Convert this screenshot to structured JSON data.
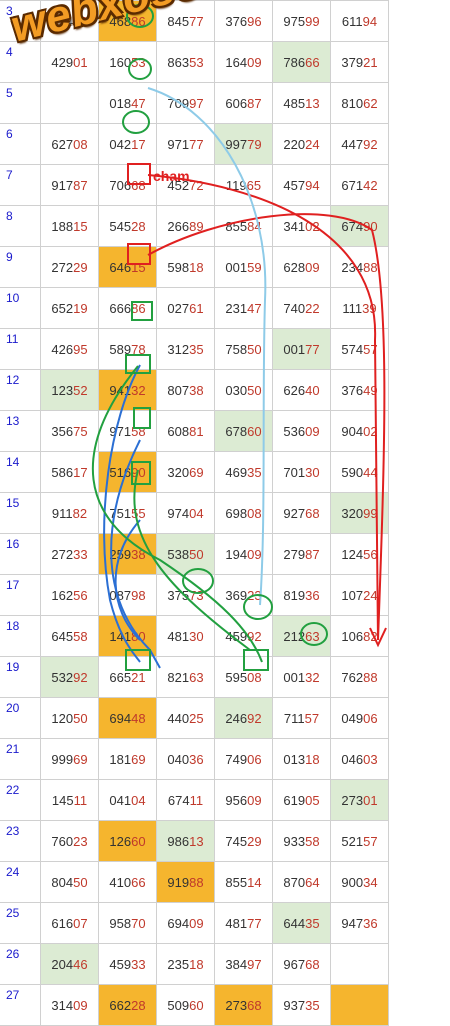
{
  "watermark": "webxoso.net",
  "annotation_label": "cham",
  "colors": {
    "orange": "#f5b52e",
    "green_cell": "#dcebd3",
    "row_number": "#1a1acc",
    "tail": "#c0392b",
    "red_arrow": "#e02020",
    "green_line": "#22a040",
    "blue_line": "#2b6fd4",
    "light_blue_line": "#8ecbe8"
  },
  "rows": [
    {
      "n": "3",
      "cells": [
        "75406",
        "46886",
        "84577",
        "37696",
        "97599",
        "61194"
      ],
      "hl": [
        "",
        "o",
        "",
        "",
        "",
        ""
      ]
    },
    {
      "n": "4",
      "cells": [
        "42901",
        "16053",
        "86353",
        "16409",
        "78666",
        "37921"
      ],
      "hl": [
        "",
        "",
        "",
        "",
        "g",
        ""
      ]
    },
    {
      "n": "5",
      "cells": [
        "",
        "01847",
        "70997",
        "60687",
        "48513",
        "81062"
      ],
      "hl": [
        "",
        "",
        "",
        "",
        "",
        ""
      ]
    },
    {
      "n": "6",
      "cells": [
        "62708",
        "04217",
        "97177",
        "99779",
        "22024",
        "44792"
      ],
      "hl": [
        "",
        "",
        "",
        "g",
        "",
        ""
      ]
    },
    {
      "n": "7",
      "cells": [
        "91787",
        "70668",
        "45272",
        "11965",
        "45794",
        "67142"
      ],
      "hl": [
        "",
        "",
        "",
        "",
        "",
        ""
      ]
    },
    {
      "n": "8",
      "cells": [
        "18815",
        "54528",
        "26689",
        "85584",
        "34102",
        "67490"
      ],
      "hl": [
        "",
        "",
        "",
        "",
        "",
        "g"
      ]
    },
    {
      "n": "9",
      "cells": [
        "27229",
        "64615",
        "59818",
        "00159",
        "62809",
        "23488"
      ],
      "hl": [
        "",
        "o",
        "",
        "",
        "",
        ""
      ]
    },
    {
      "n": "10",
      "cells": [
        "65219",
        "66686",
        "02761",
        "23147",
        "74022",
        "11139"
      ],
      "hl": [
        "",
        "",
        "",
        "",
        "",
        ""
      ]
    },
    {
      "n": "11",
      "cells": [
        "42695",
        "58978",
        "31235",
        "75850",
        "00177",
        "57457"
      ],
      "hl": [
        "",
        "",
        "",
        "",
        "g",
        ""
      ]
    },
    {
      "n": "12",
      "cells": [
        "12352",
        "94132",
        "80738",
        "03050",
        "62640",
        "37649"
      ],
      "hl": [
        "g",
        "o",
        "",
        "",
        "",
        ""
      ]
    },
    {
      "n": "13",
      "cells": [
        "35675",
        "97158",
        "60881",
        "67860",
        "53609",
        "90402"
      ],
      "hl": [
        "",
        "",
        "",
        "g",
        "",
        ""
      ]
    },
    {
      "n": "14",
      "cells": [
        "58617",
        "51690",
        "32069",
        "46935",
        "70130",
        "59044"
      ],
      "hl": [
        "",
        "o",
        "",
        "",
        "",
        ""
      ]
    },
    {
      "n": "15",
      "cells": [
        "91182",
        "75155",
        "97404",
        "69808",
        "92768",
        "32099"
      ],
      "hl": [
        "",
        "",
        "",
        "",
        "",
        "g"
      ]
    },
    {
      "n": "16",
      "cells": [
        "27233",
        "25938",
        "53850",
        "19409",
        "27987",
        "12456"
      ],
      "hl": [
        "",
        "o",
        "g",
        "",
        "",
        ""
      ]
    },
    {
      "n": "17",
      "cells": [
        "16256",
        "08798",
        "37573",
        "36923",
        "81936",
        "10724"
      ],
      "hl": [
        "",
        "",
        "",
        "",
        "",
        ""
      ]
    },
    {
      "n": "18",
      "cells": [
        "64558",
        "14180",
        "48130",
        "45992",
        "21263",
        "10682"
      ],
      "hl": [
        "",
        "o",
        "",
        "",
        "g",
        ""
      ]
    },
    {
      "n": "19",
      "cells": [
        "53292",
        "66521",
        "82163",
        "59508",
        "00132",
        "76288"
      ],
      "hl": [
        "g",
        "",
        "",
        "",
        "",
        ""
      ]
    },
    {
      "n": "20",
      "cells": [
        "12050",
        "69448",
        "44025",
        "24692",
        "71157",
        "04906"
      ],
      "hl": [
        "",
        "o",
        "",
        "g",
        "",
        ""
      ]
    },
    {
      "n": "21",
      "cells": [
        "99969",
        "18169",
        "04036",
        "74906",
        "01318",
        "04603"
      ],
      "hl": [
        "",
        "",
        "",
        "",
        "",
        ""
      ]
    },
    {
      "n": "22",
      "cells": [
        "14511",
        "04104",
        "67411",
        "95609",
        "61905",
        "27301"
      ],
      "hl": [
        "",
        "",
        "",
        "",
        "",
        "g"
      ]
    },
    {
      "n": "23",
      "cells": [
        "76023",
        "12660",
        "98613",
        "74529",
        "93358",
        "52157"
      ],
      "hl": [
        "",
        "o",
        "g",
        "",
        "",
        ""
      ]
    },
    {
      "n": "24",
      "cells": [
        "80450",
        "41066",
        "91988",
        "85514",
        "87064",
        "90034"
      ],
      "hl": [
        "",
        "",
        "o",
        "",
        "",
        ""
      ]
    },
    {
      "n": "25",
      "cells": [
        "61607",
        "95870",
        "69409",
        "48177",
        "64435",
        "94736"
      ],
      "hl": [
        "",
        "",
        "",
        "",
        "g",
        ""
      ]
    },
    {
      "n": "26",
      "cells": [
        "20446",
        "45933",
        "23518",
        "38497",
        "96768",
        ""
      ],
      "hl": [
        "g",
        "",
        "",
        "",
        "",
        ""
      ]
    },
    {
      "n": "27",
      "cells": [
        "31409",
        "66228",
        "50960",
        "27368",
        "93735",
        ""
      ],
      "hl": [
        "",
        "o",
        "",
        "o",
        "",
        "o"
      ]
    }
  ]
}
